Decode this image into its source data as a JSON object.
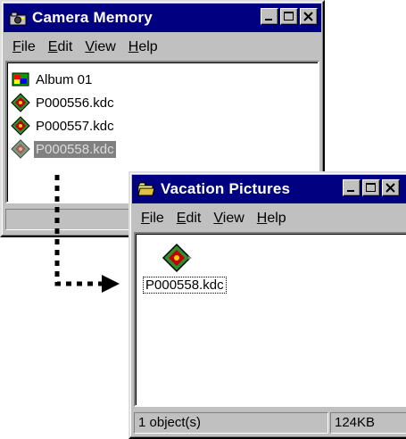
{
  "camera_window": {
    "title": "Camera Memory",
    "menu": [
      "File",
      "Edit",
      "View",
      "Help"
    ],
    "items": [
      {
        "label": "Album  01",
        "icon": "album-icon",
        "selected": false
      },
      {
        "label": "P000556.kdc",
        "icon": "kdc-image-icon",
        "selected": false
      },
      {
        "label": "P000557.kdc",
        "icon": "kdc-image-icon",
        "selected": false
      },
      {
        "label": "P000558.kdc",
        "icon": "kdc-image-icon",
        "selected": true
      }
    ]
  },
  "vacation_window": {
    "title": "Vacation Pictures",
    "menu": [
      "File",
      "Edit",
      "View",
      "Help"
    ],
    "item": {
      "label": "P000558.kdc",
      "icon": "kdc-image-icon"
    },
    "status": {
      "left": "1 object(s)",
      "right": "124KB"
    }
  },
  "colors": {
    "titlebar": "#000080",
    "window_face": "#c0c0c0",
    "selection": "#808080"
  }
}
